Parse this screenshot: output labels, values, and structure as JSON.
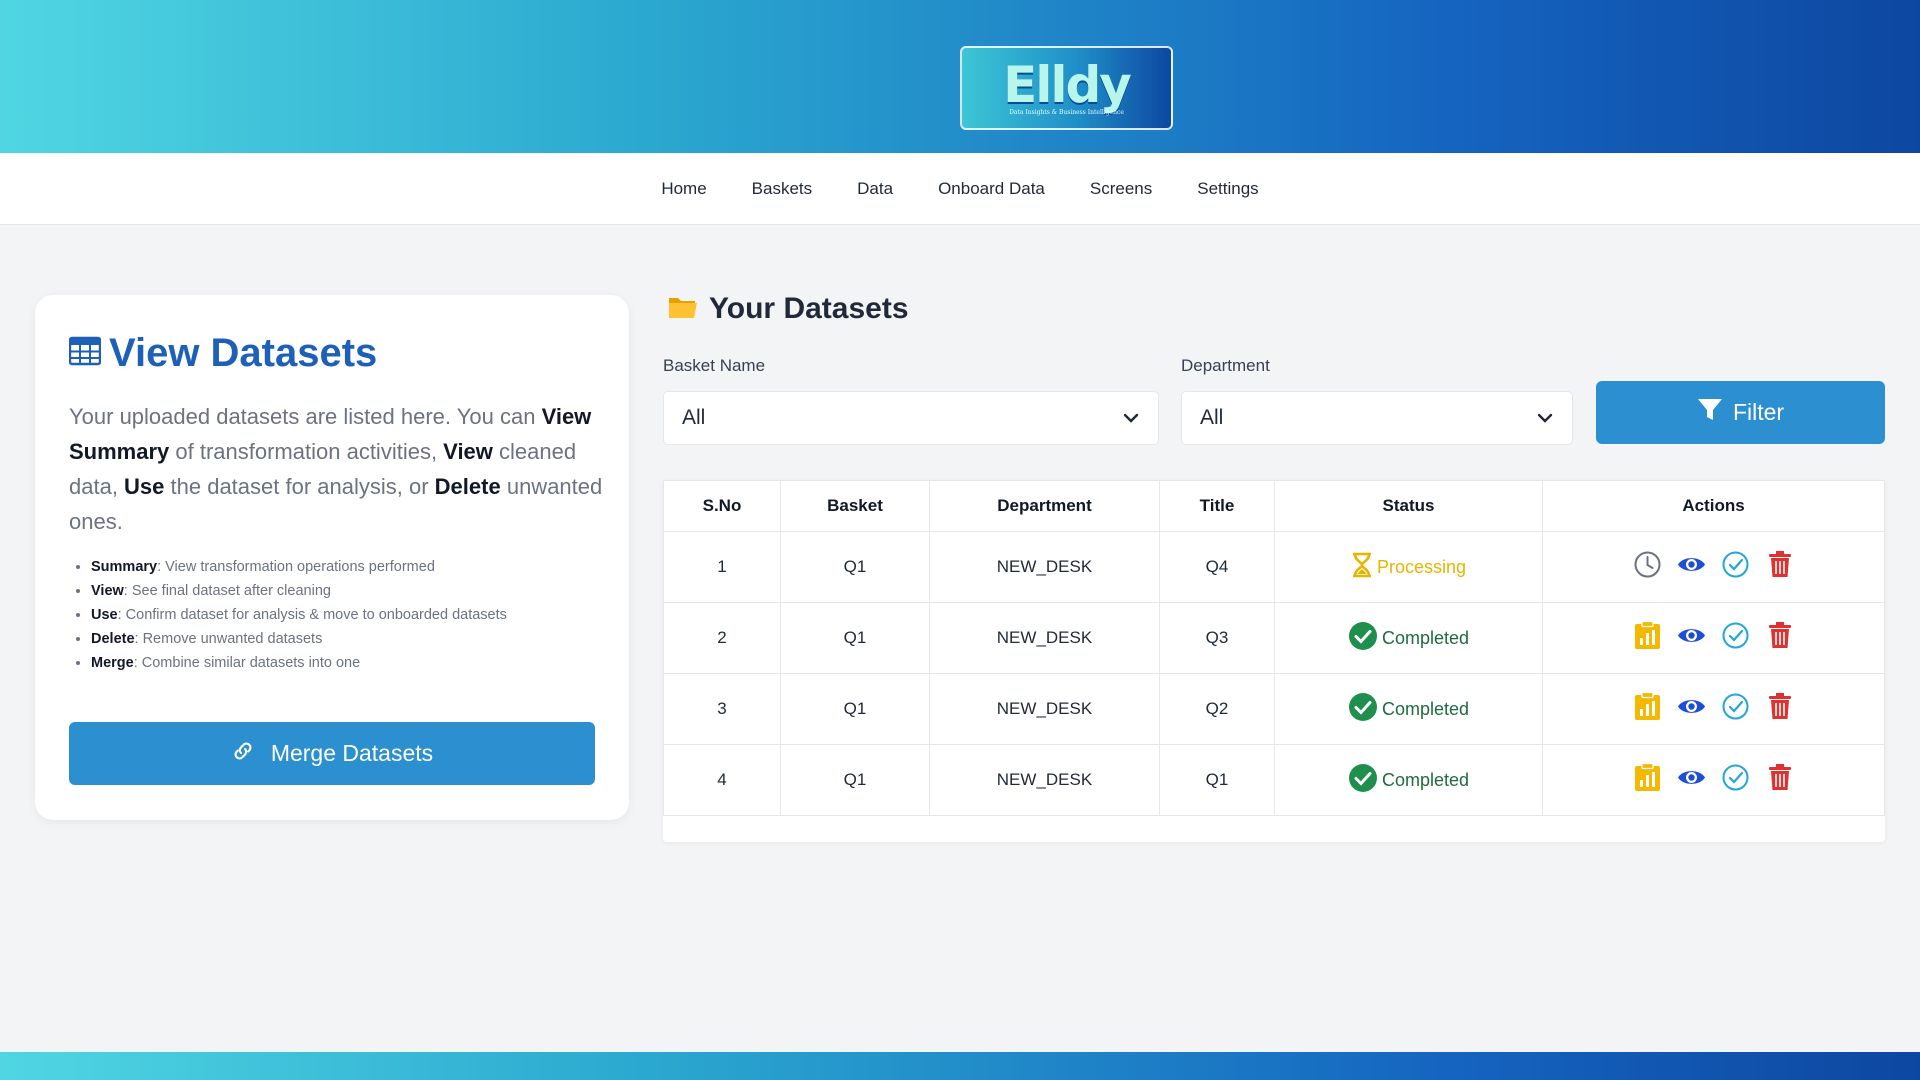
{
  "brand": {
    "logo_text": "Elldy",
    "logo_subtitle": "Data Insights & Business Intelligence"
  },
  "nav": {
    "items": [
      "Home",
      "Baskets",
      "Data",
      "Onboard Data",
      "Screens",
      "Settings"
    ]
  },
  "info": {
    "title": "View Datasets",
    "desc": {
      "p1": "Your uploaded datasets are listed here. You can ",
      "b1": "View Summary",
      "p2": " of transformation activities, ",
      "b2": "View",
      "p3": " cleaned data, ",
      "b3": "Use",
      "p4": " the dataset for analysis, or ",
      "b4": "Delete",
      "p5": " unwanted ones."
    },
    "bullets": [
      {
        "term": "Summary",
        "text": ": View transformation operations performed"
      },
      {
        "term": "View",
        "text": ": See final dataset after cleaning"
      },
      {
        "term": "Use",
        "text": ": Confirm dataset for analysis & move to onboarded datasets"
      },
      {
        "term": "Delete",
        "text": ": Remove unwanted datasets"
      },
      {
        "term": "Merge",
        "text": ": Combine similar datasets into one"
      }
    ],
    "merge_label": "Merge Datasets"
  },
  "datasets": {
    "title": "Your Datasets",
    "basket_label": "Basket Name",
    "basket_value": "All",
    "department_label": "Department",
    "department_value": "All",
    "filter_label": "Filter",
    "columns": [
      "S.No",
      "Basket",
      "Department",
      "Title",
      "Status",
      "Actions"
    ],
    "rows": [
      {
        "sno": "1",
        "basket": "Q1",
        "department": "NEW_DESK",
        "title": "Q4",
        "status": "Processing",
        "summary_icon": "clock-icon"
      },
      {
        "sno": "2",
        "basket": "Q1",
        "department": "NEW_DESK",
        "title": "Q3",
        "status": "Completed",
        "summary_icon": "summary-clipboard-icon"
      },
      {
        "sno": "3",
        "basket": "Q1",
        "department": "NEW_DESK",
        "title": "Q2",
        "status": "Completed",
        "summary_icon": "summary-clipboard-icon"
      },
      {
        "sno": "4",
        "basket": "Q1",
        "department": "NEW_DESK",
        "title": "Q1",
        "status": "Completed",
        "summary_icon": "summary-clipboard-icon"
      }
    ]
  },
  "colors": {
    "primary_button": "#2b8fd0",
    "title_blue": "#1e5fb8",
    "processing": "#e8b400",
    "completed": "#1f8f4e",
    "delete": "#e03131",
    "eye": "#1d4ed8"
  }
}
